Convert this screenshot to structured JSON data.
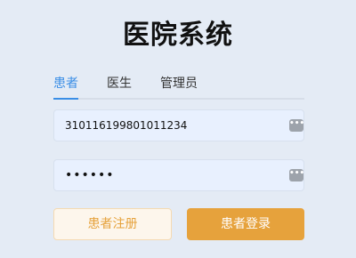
{
  "app": {
    "title": "医院系统"
  },
  "tabs": [
    {
      "label": "患者",
      "active": true
    },
    {
      "label": "医生",
      "active": false
    },
    {
      "label": "管理员",
      "active": false
    }
  ],
  "form": {
    "id_number": "310116199801011234",
    "password_masked": "••••••",
    "autofill_icon": "dots-icon"
  },
  "buttons": {
    "register_label": "患者注册",
    "login_label": "患者登录"
  },
  "colors": {
    "active_tab": "#3a8ee6",
    "warning": "#e6a23c",
    "field_bg": "#e8f0fe",
    "page_bg": "#e4ebf5"
  }
}
